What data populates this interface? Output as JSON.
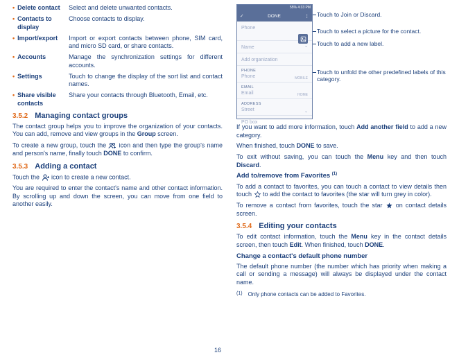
{
  "left": {
    "bullets": [
      {
        "term": "Delete contact",
        "desc": "Select and delete unwanted contacts."
      },
      {
        "term": "Contacts to display",
        "desc": "Choose contacts to display."
      },
      {
        "term": "Import/export",
        "desc": "Import or export contacts between phone, SIM card, and micro SD card, or share contacts."
      },
      {
        "term": "Accounts",
        "desc": "Manage the synchronization settings for different accounts."
      },
      {
        "term": "Settings",
        "desc": "Touch to change the display of the sort list and contact names."
      },
      {
        "term": "Share visible contacts",
        "desc": "Share your contacts through Bluetooth, Email, etc."
      }
    ],
    "sec352_num": "3.5.2",
    "sec352_title": "Managing contact groups",
    "sec352_p1a": "The contact group helps you to improve the organization of your contacts. You can add, remove and view groups in the ",
    "sec352_p1b": "Group",
    "sec352_p1c": " screen.",
    "sec352_p2a": "To create a new group, touch the ",
    "sec352_p2b": " icon and then type the group's name and person's name, finally touch ",
    "sec352_p2c": "DONE",
    "sec352_p2d": " to confirm.",
    "sec353_num": "3.5.3",
    "sec353_title": "Adding a contact",
    "sec353_p1a": "Touch the ",
    "sec353_p1b": " icon to create a new contact.",
    "sec353_p2": "You are required to enter the contact's name and other contact information. By scrolling up and down the screen, you can move from one field to another easily.",
    "page_num": "16"
  },
  "right": {
    "phone": {
      "status": "55%  4:33 PM",
      "done": "DONE",
      "phone_label": "Phone",
      "name": "Name",
      "add_org": "Add organization",
      "phone_sec": "PHONE",
      "phone_field": "Phone",
      "phone_type": "MOBILE",
      "email_sec": "EMAIL",
      "email_field": "Email",
      "email_type": "HOME",
      "addr_sec": "ADDRESS",
      "street": "Street",
      "po": "PO box"
    },
    "callouts": {
      "c1": "Touch to Join or Discard.",
      "c2": "Touch to select a picture for the contact.",
      "c3": "Touch to add a new label.",
      "c4": "Touch to unfold the other predefined labels of this category."
    },
    "p1a": "If you want to add more information, touch ",
    "p1b": "Add another field",
    "p1c": " to add a new category.",
    "p2a": "When finished, touch ",
    "p2b": "DONE",
    "p2c": " to save.",
    "p3a": "To exit without saving, you can touch the ",
    "p3b": "Menu",
    "p3c": " key and then touch ",
    "p3d": "Discard",
    "p3e": ".",
    "sub_fav": "Add to/remove from Favorites ",
    "sub_fav_sup": "(1)",
    "p4a": "To add a contact to favorites, you can touch a contact to view details then touch ",
    "p4b": " to add the contact to favorites (the star will turn grey in color).",
    "p5a": "To remove a contact from favorites, touch the star ",
    "p5b": " on contact details screen.",
    "sec354_num": "3.5.4",
    "sec354_title": "Editing your contacts",
    "p6a": "To edit contact information, touch the ",
    "p6b": "Menu",
    "p6c": " key in the contact details screen, then touch ",
    "p6d": "Edit",
    "p6dot": ". ",
    "p6e": "When finished, touch ",
    "p6f": "DONE",
    "p6g": ".",
    "sub_change": "Change a contact's default phone number",
    "p7": "The default phone number (the number which has priority when making a call or sending a message) will always be displayed under the contact name.",
    "footnote_mark": "(1)",
    "footnote": "Only phone contacts can be added to Favorites."
  }
}
